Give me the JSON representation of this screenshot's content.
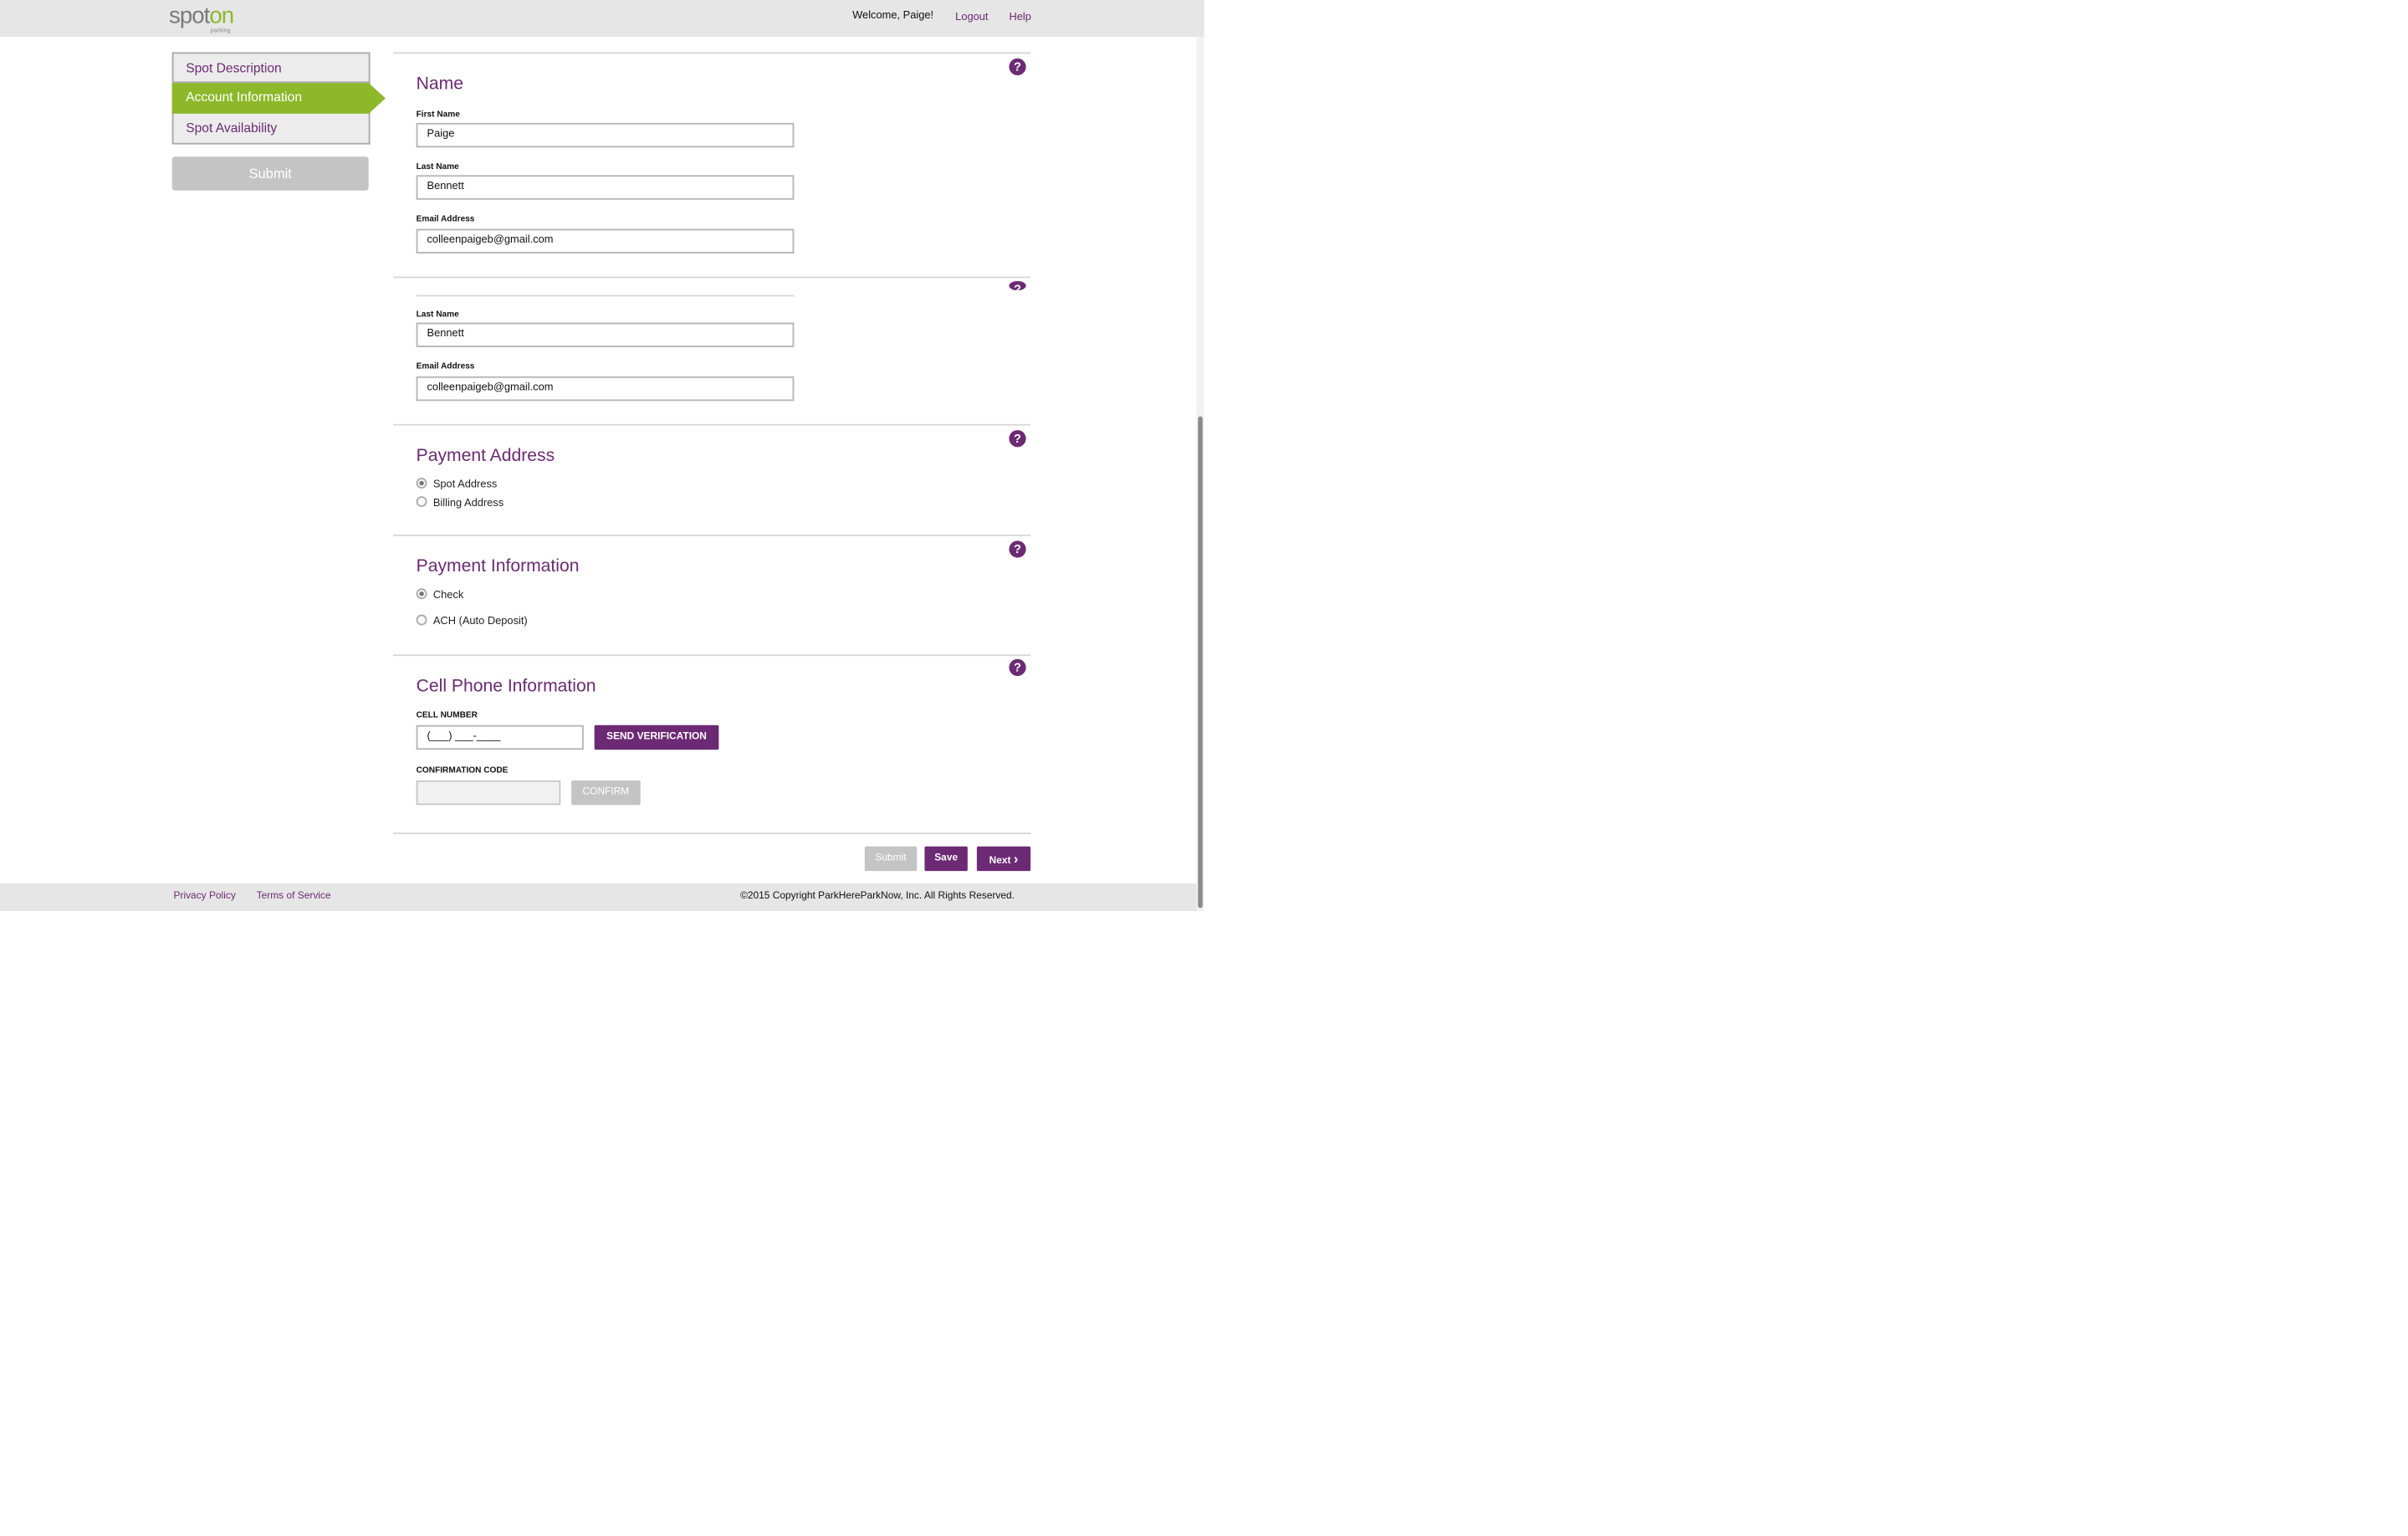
{
  "header": {
    "logo_main_a": "spot",
    "logo_main_b": "on",
    "logo_sub": "parking",
    "welcome": "Welcome, Paige!",
    "logout": "Logout",
    "help": "Help"
  },
  "sidebar": {
    "items": [
      {
        "label": "Spot Description"
      },
      {
        "label": "Account Information"
      },
      {
        "label": "Spot Availability"
      }
    ],
    "submit": "Submit"
  },
  "name_section": {
    "title": "Name",
    "first_name_label": "First Name",
    "first_name_value": "Paige",
    "last_name_label": "Last Name",
    "last_name_value": "Bennett",
    "email_label": "Email Address",
    "email_value": "colleenpaigeb@gmail.com"
  },
  "second_section": {
    "last_name_label": "Last Name",
    "last_name_value": "Bennett",
    "email_label": "Email Address",
    "email_value": "colleenpaigeb@gmail.com"
  },
  "payment_address": {
    "title": "Payment Address",
    "options": [
      "Spot Address",
      "Billing Address"
    ],
    "selected": "Spot Address"
  },
  "payment_information": {
    "title": "Payment Information",
    "options": [
      "Check",
      "ACH (Auto Deposit)"
    ],
    "selected": "Check"
  },
  "cell_phone": {
    "title": "Cell Phone Information",
    "cell_label": "CELL NUMBER",
    "cell_placeholder": "(___) ___-____",
    "send_button": "SEND VERIFICATION",
    "code_label": "CONFIRMATION CODE",
    "confirm_button": "CONFIRM"
  },
  "help_icon_text": "?",
  "actions": {
    "submit": "Submit",
    "save": "Save",
    "next": "Next",
    "next_chevron": "›"
  },
  "footer": {
    "privacy": "Privacy Policy",
    "terms": "Terms of Service",
    "copyright": "©2015 Copyright ParkHereParkNow, Inc. All Rights Reserved."
  },
  "colors": {
    "brand_purple": "#6c2a74",
    "brand_green": "#8cb82a",
    "disabled_grey": "#c4c4c4"
  }
}
